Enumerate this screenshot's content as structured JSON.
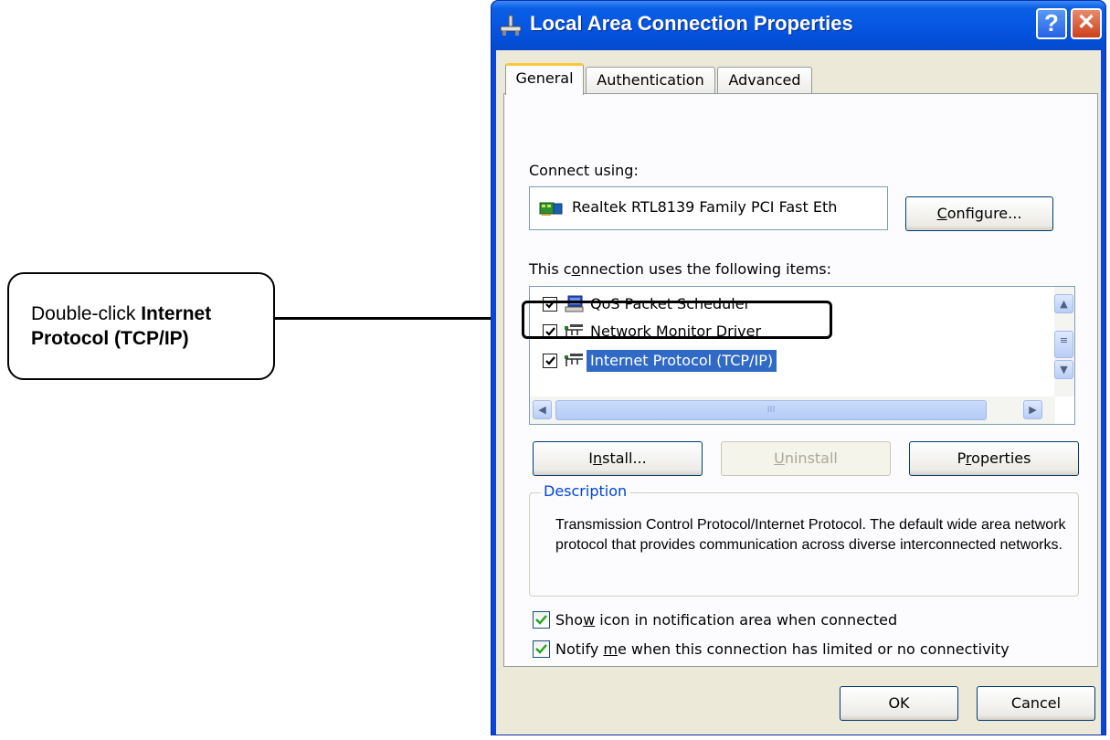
{
  "callout": {
    "prefix": "Double-click ",
    "bold1": "Internet",
    "bold2": "Protocol (TCP/IP)"
  },
  "window": {
    "title": "Local Area Connection Properties",
    "help_glyph": "?",
    "close_glyph": "✕"
  },
  "tabs": [
    {
      "label": "General",
      "active": true
    },
    {
      "label": "Authentication",
      "active": false
    },
    {
      "label": "Advanced",
      "active": false
    }
  ],
  "general": {
    "connect_using_label": "Connect using:",
    "adapter_name": "Realtek RTL8139 Family PCI Fast Eth",
    "configure_pre": "C",
    "configure_rest": "onfigure...",
    "items_label_pre": "This c",
    "items_label_ul": "o",
    "items_label_post": "nnection uses the following items:",
    "items": [
      {
        "label": "QoS Packet Scheduler",
        "checked": true,
        "icon": "network-computer-icon",
        "selected": false
      },
      {
        "label": "Network Monitor Driver",
        "checked": true,
        "icon": "network-protocol-icon",
        "selected": false
      },
      {
        "label": "Internet Protocol (TCP/IP)",
        "checked": true,
        "icon": "network-protocol-icon",
        "selected": true
      }
    ],
    "hscroll_grip": "III",
    "install_pre": "I",
    "install_ul": "n",
    "install_post": "stall...",
    "uninstall_pre": "",
    "uninstall_ul": "U",
    "uninstall_post": "ninstall",
    "properties_pre": "P",
    "properties_ul": "r",
    "properties_post": "operties",
    "description_title": "Description",
    "description_text": "Transmission Control Protocol/Internet Protocol. The default wide area network protocol that provides communication across diverse interconnected networks.",
    "show_icon_pre": "Sho",
    "show_icon_ul": "w",
    "show_icon_post": " icon in notification area when connected",
    "show_icon_checked": true,
    "notify_pre": "Notify ",
    "notify_ul": "m",
    "notify_post": "e when this connection has limited or no connectivity",
    "notify_checked": true
  },
  "footer": {
    "ok_label": "OK",
    "cancel_label": "Cancel"
  },
  "colors": {
    "titlebar": "#0554e0",
    "selection": "#316ac5",
    "check_green": "#21a121",
    "legend_blue": "#0046d5"
  }
}
